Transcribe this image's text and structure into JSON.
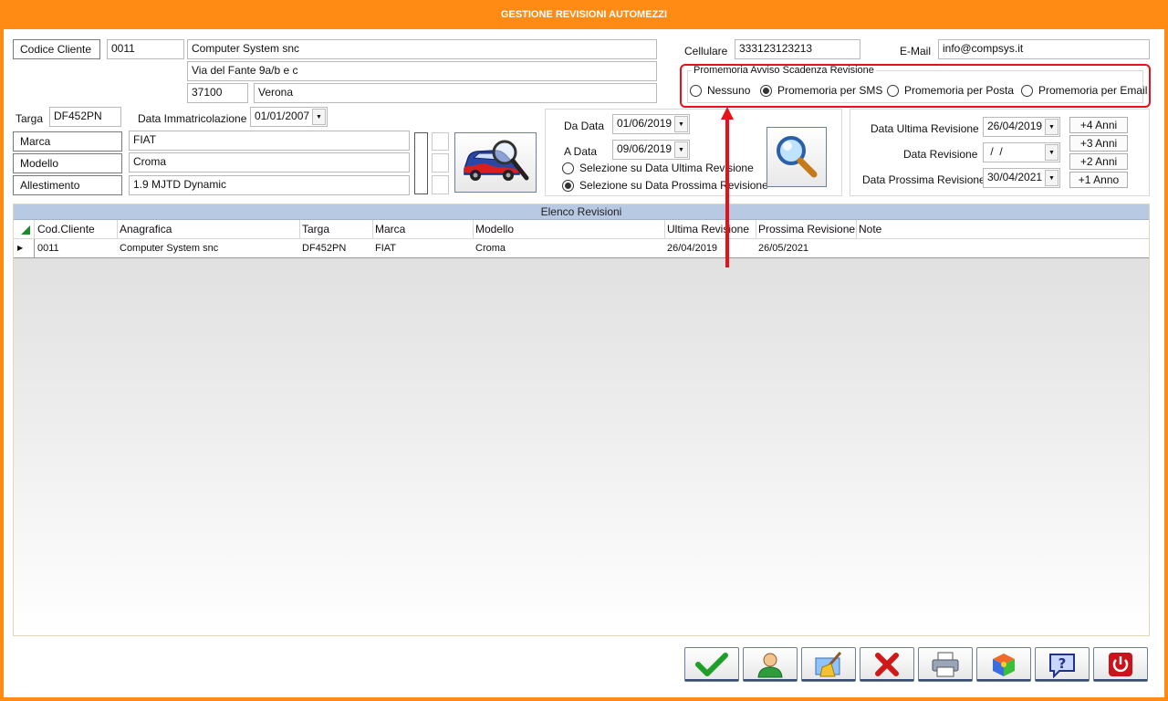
{
  "window": {
    "title": "GESTIONE REVISIONI AUTOMEZZI"
  },
  "client": {
    "codice_label": "Codice Cliente",
    "codice": "0011",
    "ragione_sociale": "Computer System snc",
    "indirizzo": "Via del Fante 9a/b e c",
    "cap": "37100",
    "citta": "Verona",
    "cellulare_label": "Cellulare",
    "cellulare": "333123123213",
    "email_label": "E-Mail",
    "email": "info@compsys.it"
  },
  "promemoria": {
    "legend": "Promemoria Avviso Scadenza Revisione",
    "options": [
      "Nessuno",
      "Promemoria per SMS",
      "Promemoria per Posta",
      "Promemoria per Email"
    ],
    "selected": "Promemoria per SMS"
  },
  "vehicle": {
    "targa_label": "Targa",
    "targa": "DF452PN",
    "immatricolazione_label": "Data Immatricolazione",
    "immatricolazione": "01/01/2007",
    "marca_label": "Marca",
    "marca": "FIAT",
    "modello_label": "Modello",
    "modello": "Croma",
    "allestimento_label": "Allestimento",
    "allestimento": "1.9 MJTD Dynamic"
  },
  "filter": {
    "da_data_label": "Da Data",
    "da_data": "01/06/2019",
    "a_data_label": "A Data",
    "a_data": "09/06/2019",
    "options": [
      "Selezione su Data Ultima Revisione",
      "Selezione su Data Prossima Revisione"
    ],
    "selected": "Selezione su Data Prossima Revisione"
  },
  "revisione": {
    "ultima_label": "Data Ultima Revisione",
    "ultima": "26/04/2019",
    "data_label": "Data Revisione",
    "data": " /  /",
    "prossima_label": "Data Prossima Revisione",
    "prossima": "30/04/2021",
    "buttons": [
      "+4 Anni",
      "+3 Anni",
      "+2 Anni",
      "+1 Anno"
    ]
  },
  "grid": {
    "title": "Elenco Revisioni",
    "columns": [
      "Cod.Cliente",
      "Anagrafica",
      "Targa",
      "Marca",
      "Modello",
      "Ultima Revisione",
      "Prossima Revisione",
      "Note"
    ],
    "rows": [
      [
        "0011",
        "Computer System snc",
        "DF452PN",
        "FIAT",
        "Croma",
        "26/04/2019",
        "26/05/2021",
        ""
      ]
    ]
  },
  "toolbar": {
    "icons": [
      "confirm-check-icon",
      "user-icon",
      "clear-broom-icon",
      "cancel-x-icon",
      "printer-icon",
      "cube-icon",
      "help-icon",
      "power-icon"
    ]
  },
  "colors": {
    "title_bar": "#ff8a14",
    "grid_header": "#b7c9e3",
    "annotation": "#e8101a"
  }
}
